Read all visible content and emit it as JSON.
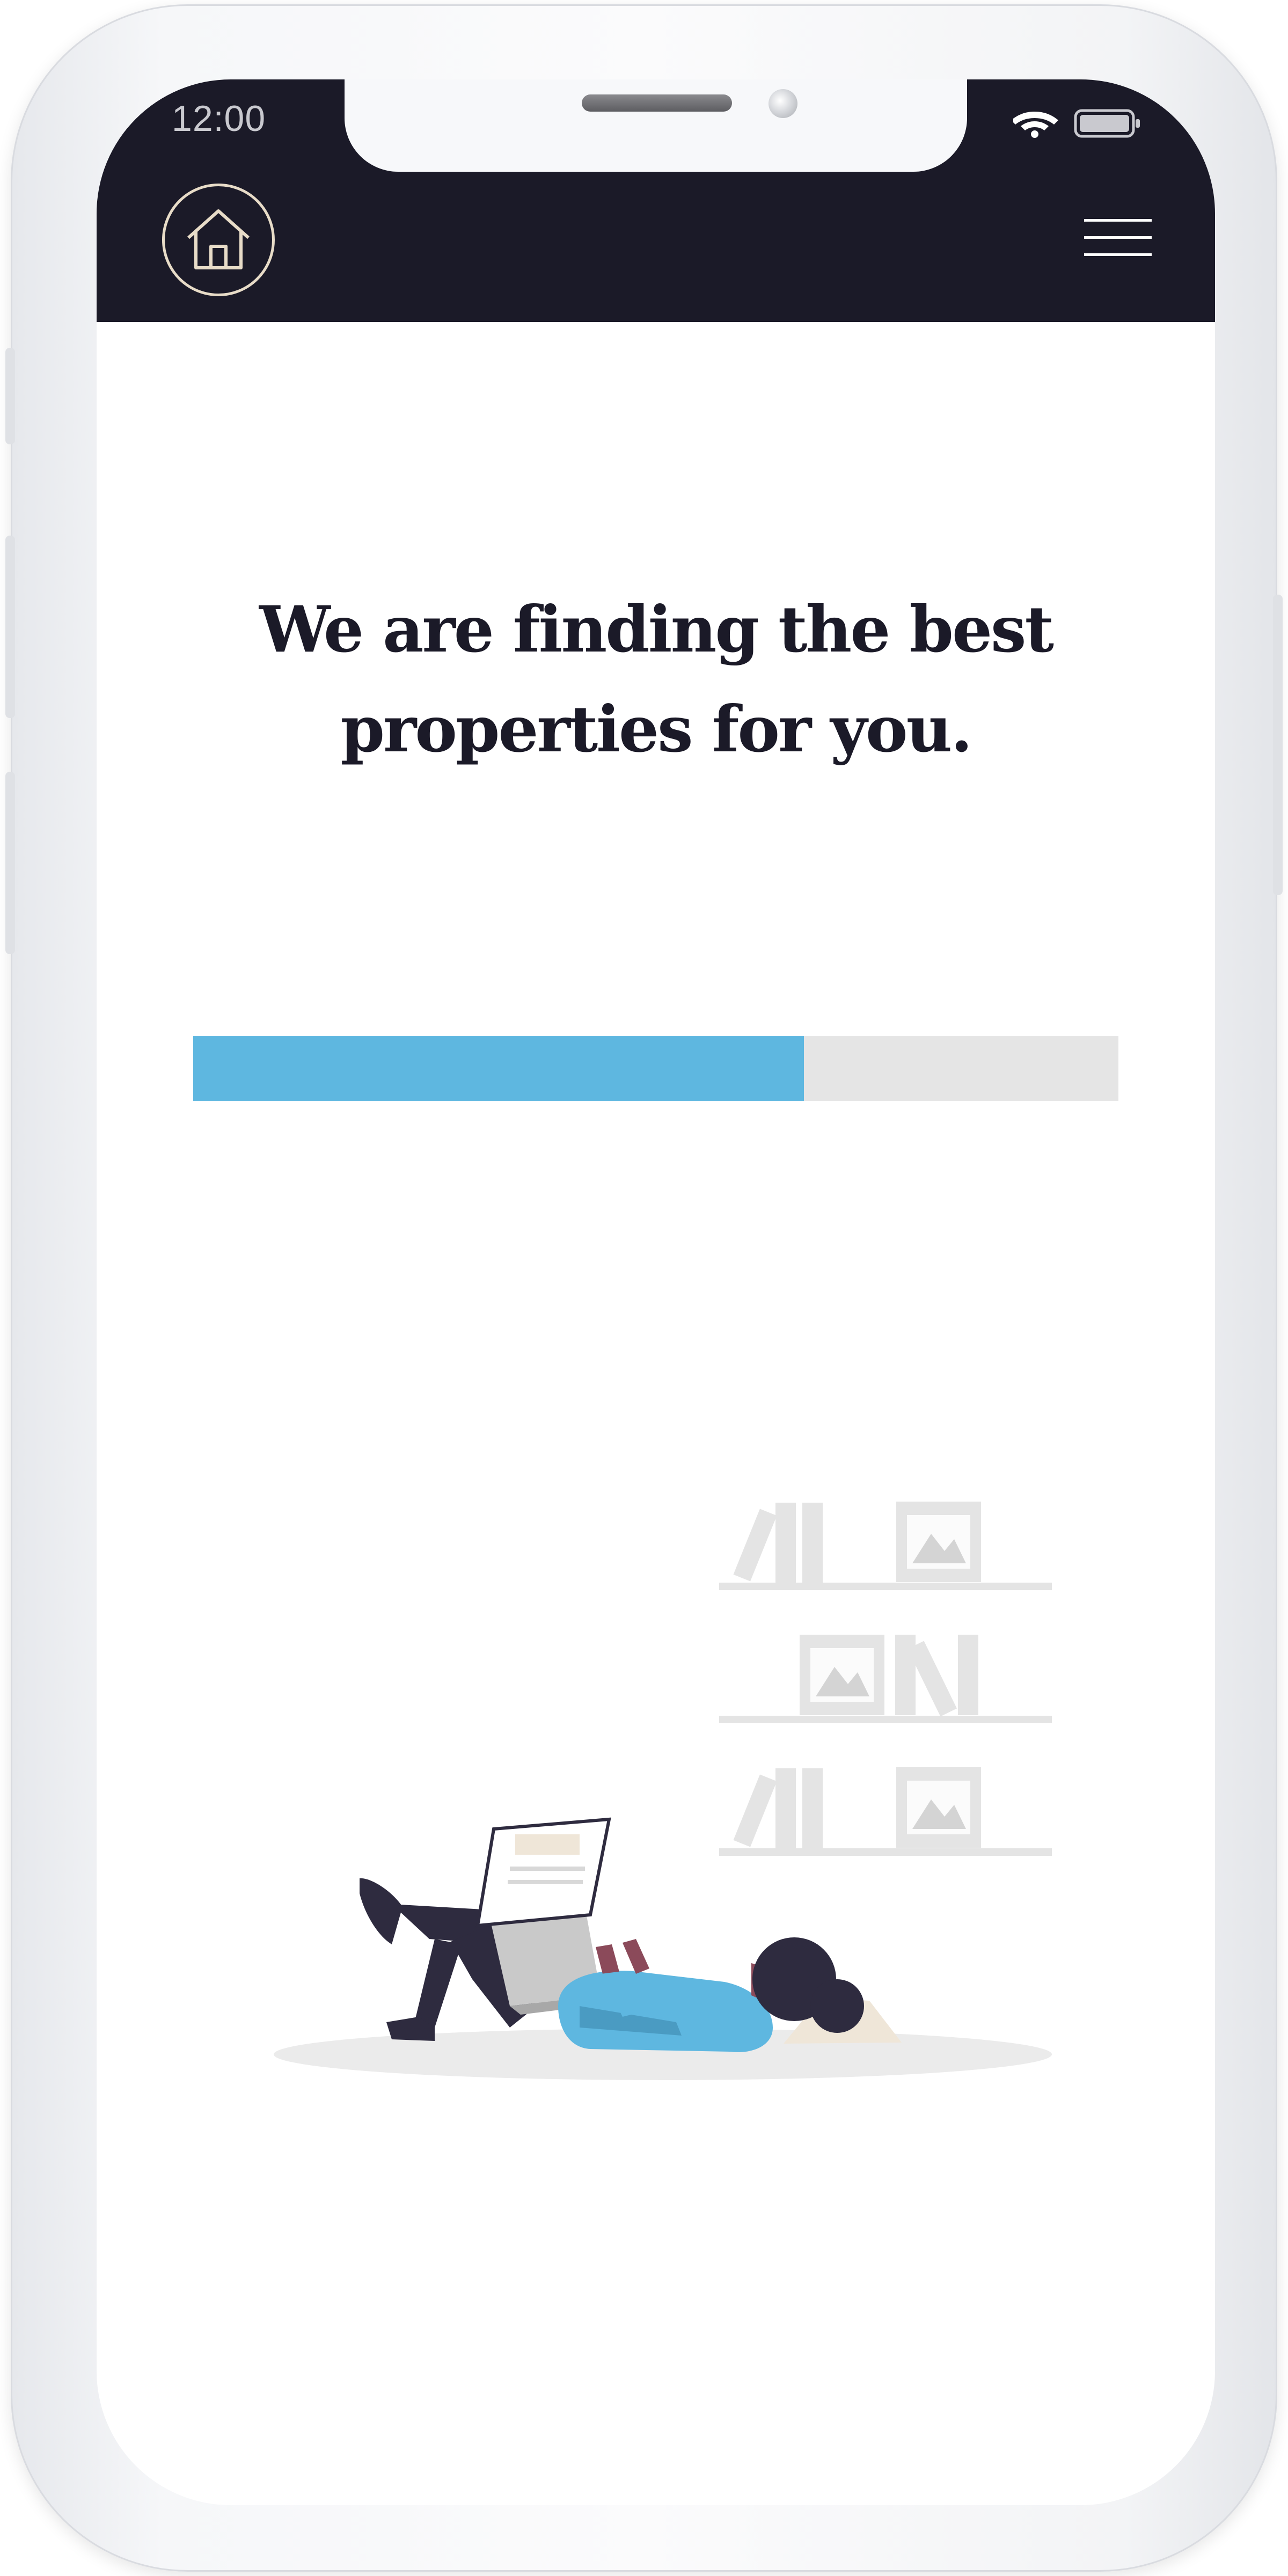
{
  "status_bar": {
    "time": "12:00",
    "icons": [
      "wifi-icon",
      "battery-icon"
    ]
  },
  "header": {
    "logo_icon": "home-icon",
    "menu_icon": "hamburger-menu-icon"
  },
  "main": {
    "headline": "We are finding the best properties for you.",
    "progress": {
      "value_percent": 66
    },
    "illustration_icon": "person-reading-laptop-illustration"
  },
  "colors": {
    "header_bg": "#1b1a28",
    "accent": "#5eb7e0",
    "track": "#e5e5e5",
    "text": "#1b1a28",
    "logo_stroke": "#e8dcc8"
  }
}
